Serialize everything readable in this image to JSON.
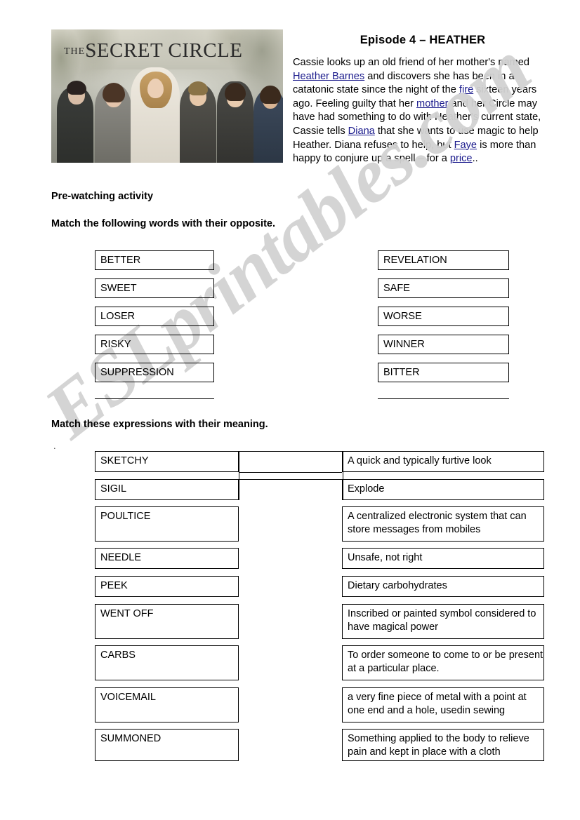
{
  "document": {
    "poster": {
      "show_title_prefix": "THE",
      "show_title_main": "SECRET CIRCLE",
      "alt": "secret-circle-cast-photo"
    },
    "episode_title": "Episode 4 – HEATHER",
    "episode_summary_parts": [
      {
        "text": "Cassie looks up an old friend of her mother's named ",
        "link": false
      },
      {
        "text": "Heather Barnes",
        "link": true
      },
      {
        "text": " and discovers she has been in a catatonic state since the night of the ",
        "link": false
      },
      {
        "text": "fire",
        "link": true
      },
      {
        "text": " sixteen years ago. Feeling guilty that her ",
        "link": false
      },
      {
        "text": "mother",
        "link": true
      },
      {
        "text": " and her Circle may have had something to do with Heather's current state, Cassie tells ",
        "link": false
      },
      {
        "text": "Diana",
        "link": true
      },
      {
        "text": " that she wants to use magic to help Heather. Diana refuses to help, but ",
        "link": false
      },
      {
        "text": "Faye",
        "link": true
      },
      {
        "text": " is more than happy to conjure up a spell – for a ",
        "link": false
      },
      {
        "text": "price",
        "link": true
      },
      {
        "text": "..",
        "link": false
      }
    ],
    "headings": {
      "prewatching": "Pre-watching activity",
      "opposites": "Match the following words with their opposite.",
      "meanings": "Match these expressions with their meaning.",
      "stray_dot": "."
    },
    "exercise_opposites": {
      "left_column": [
        "BETTER",
        "SWEET",
        "LOSER",
        "RISKY",
        "SUPPRESSION"
      ],
      "right_column": [
        "REVELATION",
        "SAFE",
        "WORSE",
        "WINNER",
        "BITTER"
      ]
    },
    "exercise_meanings": {
      "terms": [
        "SKETCHY",
        "SIGIL",
        "POULTICE",
        "NEEDLE",
        "PEEK",
        "WENT OFF",
        "CARBS",
        "VOICEMAIL",
        "SUMMONED"
      ],
      "definitions": [
        "A quick and typically furtive look",
        "Explode",
        "A centralized electronic system that can store messages from mobiles",
        "Unsafe, not right",
        "Dietary carbohydrates",
        "Inscribed or painted symbol considered to have magical power",
        "To order someone to come to or be present at a particular place.",
        "a very fine piece of metal with a point at one end and a hole, usedin sewing",
        "Something applied to the body to relieve pain and kept in place with a cloth"
      ]
    },
    "watermark": {
      "text": "ESLprintables.com",
      "color": "#d2d2d2"
    },
    "colors": {
      "page_background": "#ffffff",
      "text": "#000000",
      "link": "#1a1a8c",
      "border": "#000000"
    }
  }
}
